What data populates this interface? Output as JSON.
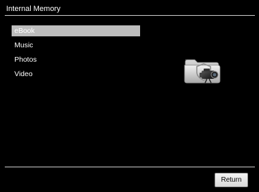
{
  "window": {
    "title": "Internal Memory"
  },
  "menu": {
    "items": [
      {
        "label": "eBook",
        "selected": true
      },
      {
        "label": "Music",
        "selected": false
      },
      {
        "label": "Photos",
        "selected": false
      },
      {
        "label": "Video",
        "selected": false
      }
    ]
  },
  "preview": {
    "icon": "video-folder-icon"
  },
  "footer": {
    "return_label": "Return"
  },
  "colors": {
    "background": "#000000",
    "text": "#ffffff",
    "selection": "#bdbdbd",
    "rule": "#d0d0d0"
  }
}
